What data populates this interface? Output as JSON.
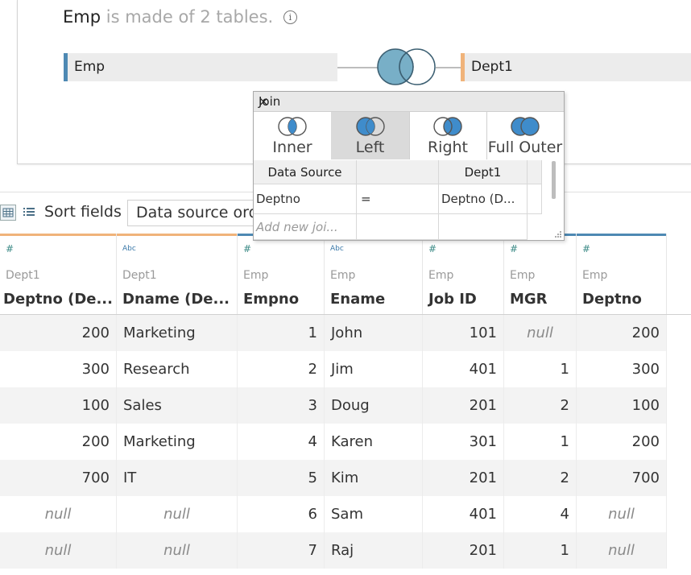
{
  "canvas": {
    "table_name": "Emp",
    "subtitle": "is made of 2 tables.",
    "info_glyph": "i",
    "left_table": "Emp",
    "right_table": "Dept1",
    "colors": {
      "emp": "#4e89b3",
      "dept": "#f0b37a",
      "venn_fill": "#78afc7"
    }
  },
  "join_dialog": {
    "title": "Join",
    "close": "×",
    "types": [
      {
        "label": "Inner",
        "selected": false
      },
      {
        "label": "Left",
        "selected": true
      },
      {
        "label": "Right",
        "selected": false
      },
      {
        "label": "Full Outer",
        "selected": false
      }
    ],
    "header_left": "Data Source",
    "header_right": "Dept1",
    "clause_left": "Deptno",
    "clause_op": "=",
    "clause_right": "Deptno (D...",
    "add_placeholder": "Add new joi..."
  },
  "toolbar": {
    "sort_label": "Sort fields",
    "sort_value": "Data source ord"
  },
  "grid": {
    "columns": [
      {
        "type_icon": "#",
        "source": "Dept1",
        "name": "Deptno (De..."
      },
      {
        "type_icon": "Abc",
        "source": "Dept1",
        "name": "Dname (De..."
      },
      {
        "type_icon": "#",
        "source": "Emp",
        "name": "Empno"
      },
      {
        "type_icon": "Abc",
        "source": "Emp",
        "name": "Ename"
      },
      {
        "type_icon": "#",
        "source": "Emp",
        "name": "Job ID"
      },
      {
        "type_icon": "#",
        "source": "Emp",
        "name": "MGR"
      },
      {
        "type_icon": "#",
        "source": "Emp",
        "name": "Deptno"
      }
    ],
    "rows": [
      [
        "200",
        "Marketing",
        "1",
        "John",
        "101",
        "null",
        "200"
      ],
      [
        "300",
        "Research",
        "2",
        "Jim",
        "401",
        "1",
        "300"
      ],
      [
        "100",
        "Sales",
        "3",
        "Doug",
        "201",
        "2",
        "100"
      ],
      [
        "200",
        "Marketing",
        "4",
        "Karen",
        "301",
        "1",
        "200"
      ],
      [
        "700",
        "IT",
        "5",
        "Kim",
        "201",
        "2",
        "700"
      ],
      [
        "null",
        "null",
        "6",
        "Sam",
        "401",
        "4",
        "null"
      ],
      [
        "null",
        "null",
        "7",
        "Raj",
        "201",
        "1",
        "null"
      ]
    ]
  }
}
